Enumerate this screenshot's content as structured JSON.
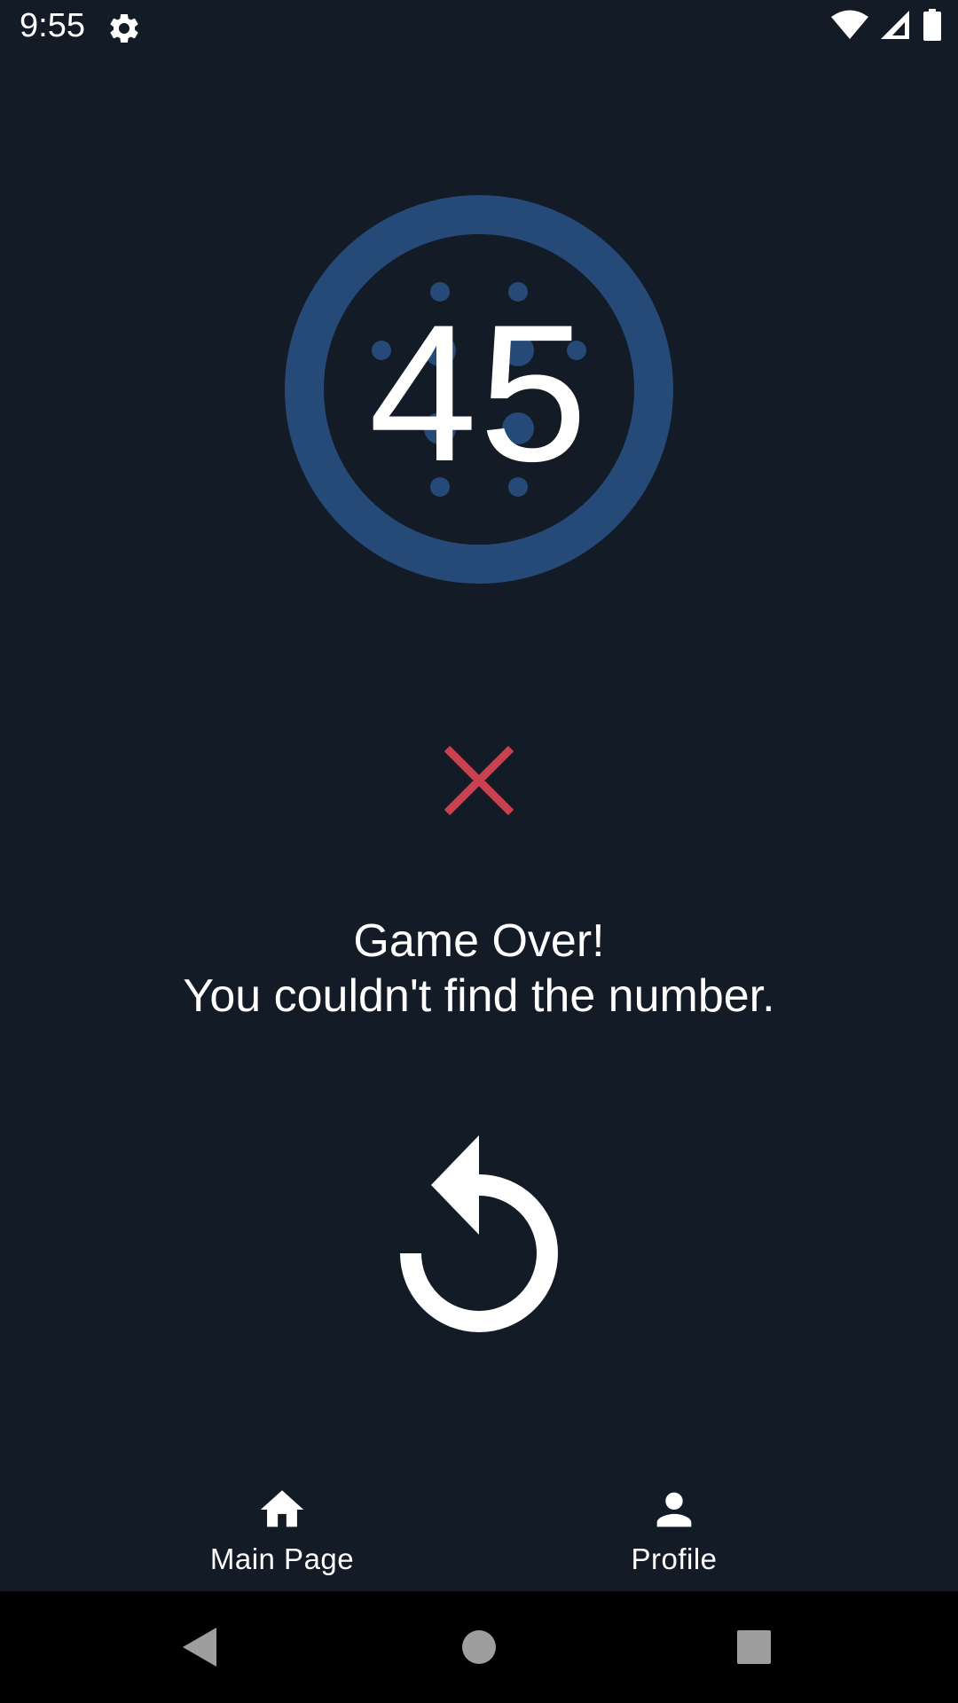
{
  "status_bar": {
    "time": "9:55",
    "icons": [
      "gear-icon",
      "wifi-icon",
      "signal-icon",
      "battery-icon"
    ]
  },
  "game": {
    "number": "45",
    "result_icon": "close-icon",
    "message_line1": "Game Over!",
    "message_line2": "You couldn't find the number.",
    "replay_icon": "replay-icon"
  },
  "bottom_nav": {
    "items": [
      {
        "label": "Main Page",
        "icon": "home-icon"
      },
      {
        "label": "Profile",
        "icon": "person-icon"
      }
    ]
  },
  "system_nav": {
    "icons": [
      "back-icon",
      "home-circle-icon",
      "recents-icon"
    ]
  },
  "colors": {
    "background": "#131b26",
    "dial_ring": "#264a77",
    "fail": "#c9414e",
    "text": "#ffffff",
    "system_nav": "#000000"
  }
}
